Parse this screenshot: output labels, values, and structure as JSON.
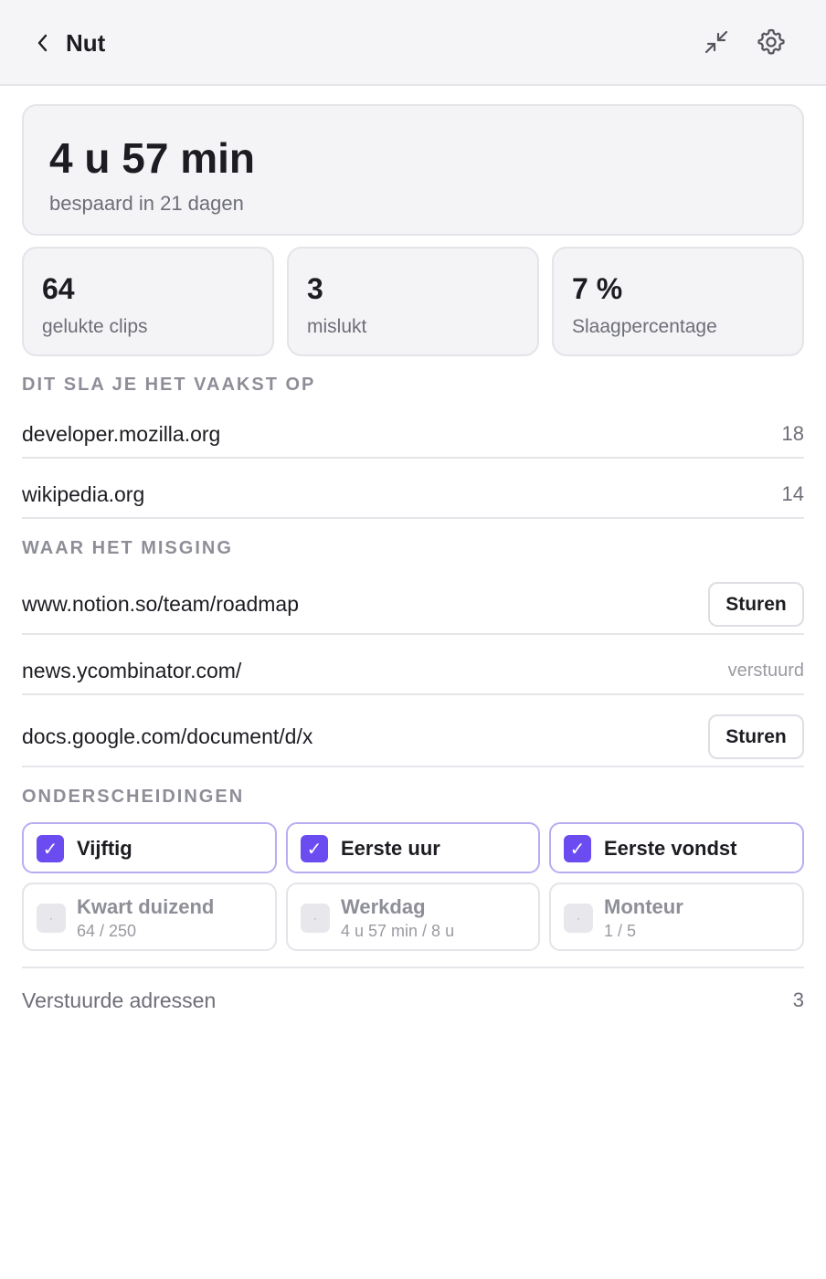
{
  "header": {
    "title": "Nut"
  },
  "hero": {
    "value": "4 u 57 min",
    "subtitle": "bespaard in 21 dagen"
  },
  "stats": [
    {
      "value": "64",
      "label": "gelukte clips"
    },
    {
      "value": "3",
      "label": "mislukt"
    },
    {
      "value": "7 %",
      "label": "Slaagpercentage"
    }
  ],
  "top_sites": {
    "title": "DIT SLA JE HET VAAKST OP",
    "items": [
      {
        "site": "developer.mozilla.org",
        "count": "18"
      },
      {
        "site": "wikipedia.org",
        "count": "14"
      }
    ]
  },
  "failures": {
    "title": "WAAR HET MISGING",
    "items": [
      {
        "url": "www.notion.so/team/roadmap",
        "action": "Sturen"
      },
      {
        "url": "news.ycombinator.com/",
        "status": "verstuurd"
      },
      {
        "url": "docs.google.com/document/d/x",
        "action": "Sturen"
      }
    ]
  },
  "awards": {
    "title": "ONDERSCHEIDINGEN",
    "earned": [
      {
        "label": "Vijftig",
        "check": "✓"
      },
      {
        "label": "Eerste uur",
        "check": "✓"
      },
      {
        "label": "Eerste vondst",
        "check": "✓"
      }
    ],
    "locked": [
      {
        "label": "Kwart duizend",
        "progress": "64 / 250",
        "marker": "·"
      },
      {
        "label": "Werkdag",
        "progress": "4 u 57 min / 8 u",
        "marker": "·"
      },
      {
        "label": "Monteur",
        "progress": "1 / 5",
        "marker": "·"
      }
    ]
  },
  "footer": {
    "label": "Verstuurde adressen",
    "value": "3"
  },
  "colors": {
    "accent": "#6a4cf0",
    "accent_border": "#b9adf2"
  }
}
